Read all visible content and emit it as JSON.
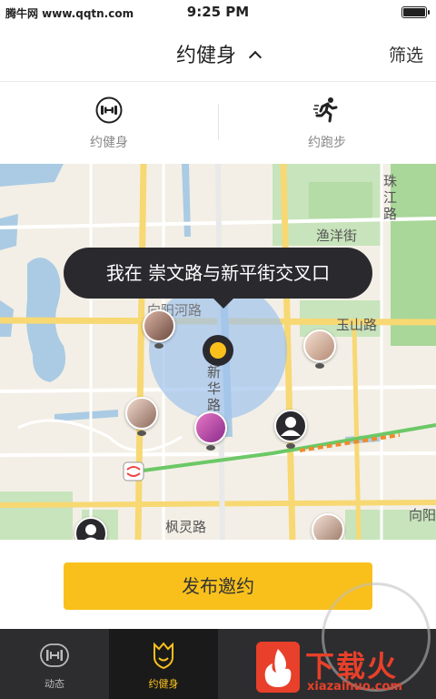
{
  "status_bar": {
    "watermark": "腾牛网 www.qqtn.com",
    "time": "9:25 PM"
  },
  "nav": {
    "title": "约健身",
    "filter_label": "筛选"
  },
  "modes": [
    {
      "label": "约健身",
      "icon": "dumbbell-icon"
    },
    {
      "label": "约跑步",
      "icon": "runner-icon"
    }
  ],
  "map": {
    "location_bubble": "我在 崇文路与新平街交叉口",
    "road_labels": {
      "zhujiang": "珠江路",
      "yuyang": "渔洋街",
      "xiangyanghe": "向阳河路",
      "yushan": "玉山路",
      "xinhua": "新华路",
      "fengling": "枫灵路",
      "xiangyang": "向阳"
    },
    "accent_color": "#f9c01c"
  },
  "publish_button": "发布邀约",
  "tabbar": [
    {
      "label": "动态",
      "icon": "dumbbell-icon",
      "active": false
    },
    {
      "label": "约健身",
      "icon": "shield-crown-icon",
      "active": true
    }
  ],
  "watermark_logo": {
    "text": "下载火",
    "url_text": "xiazaihuo.com"
  }
}
